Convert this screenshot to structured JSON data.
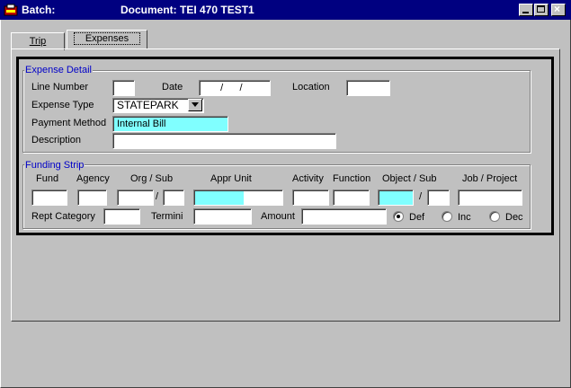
{
  "window": {
    "app_title": "Batch:",
    "document_title": "Document: TEI  470  TEST1"
  },
  "tabs": [
    {
      "label": "Trip",
      "active": false
    },
    {
      "label": "Expenses",
      "active": true
    }
  ],
  "expense_detail": {
    "legend": "Expense Detail",
    "line_number_label": "Line Number",
    "line_number_value": "",
    "date_label": "Date",
    "date_value": "   /      /",
    "location_label": "Location",
    "location_value": "",
    "expense_type_label": "Expense Type",
    "expense_type_value": "STATEPARK",
    "payment_method_label": "Payment Method",
    "payment_method_value": "Internal Bill",
    "description_label": "Description",
    "description_value": ""
  },
  "funding_strip": {
    "legend": "Funding Strip",
    "headers": {
      "fund": "Fund",
      "agency": "Agency",
      "org_sub": "Org / Sub",
      "appr_unit": "Appr Unit",
      "activity": "Activity",
      "function": "Function",
      "object_sub": "Object / Sub",
      "job_project": "Job / Project"
    },
    "slash": "/",
    "rept_category_label": "Rept Category",
    "termini_label": "Termini",
    "amount_label": "Amount",
    "radios": [
      {
        "label": "Def",
        "checked": true
      },
      {
        "label": "Inc",
        "checked": false
      },
      {
        "label": "Dec",
        "checked": false
      }
    ]
  },
  "colors": {
    "title_bar": "#000080",
    "highlight_field": "#80ffff",
    "legend_text": "#0000c8",
    "background": "#c0c0c0"
  }
}
